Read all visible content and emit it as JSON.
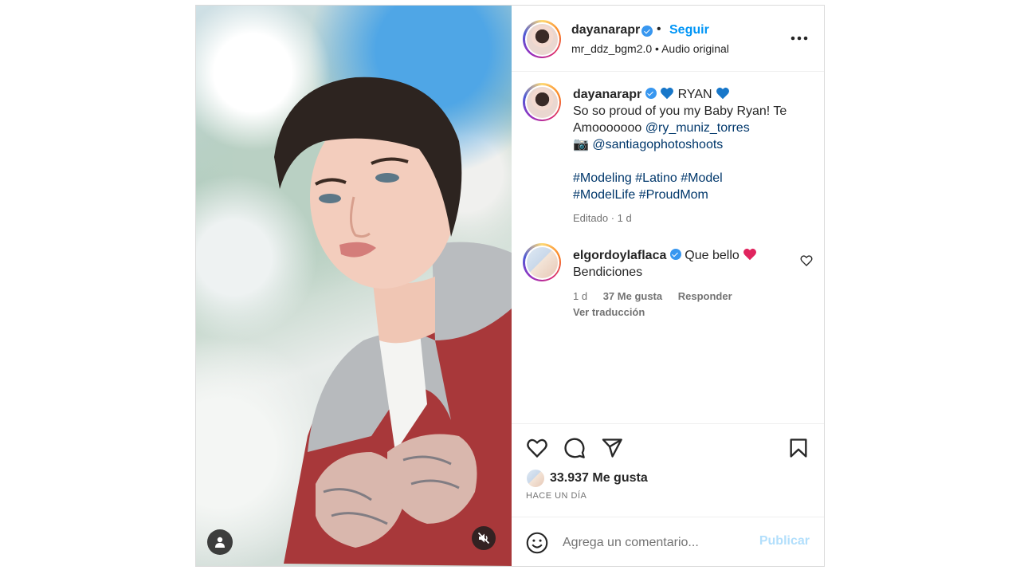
{
  "post": {
    "author": "dayanarapr",
    "follow_label": "Seguir",
    "separator": "•",
    "audio": "mr_ddz_bgm2.0 • Audio original",
    "more_icon": "more-horizontal-icon"
  },
  "caption": {
    "username": "dayanarapr",
    "line1_text": "RYAN",
    "line2": "So so proud of you my Baby Ryan! Te Amooooooo",
    "mention1": "@ry_muniz_torres",
    "camera_emoji": "📷",
    "mention2": "@santiagophotoshoots",
    "hashtags_line1": [
      "#Modeling",
      "#Latino",
      "#Model"
    ],
    "hashtags_line2": [
      "#ModelLife",
      "#ProudMom"
    ],
    "meta": "Editado · 1 d"
  },
  "comment": {
    "username": "elgordoylaflaca",
    "text": "Que bello",
    "text2": "Bendiciones",
    "time": "1 d",
    "likes": "37 Me gusta",
    "reply": "Responder",
    "translate": "Ver traducción"
  },
  "actions": {
    "likes_count": "33.937 Me gusta",
    "time_ago": "HACE UN DÍA"
  },
  "add_comment": {
    "placeholder": "Agrega un comentario...",
    "publish": "Publicar"
  },
  "colors": {
    "accent": "#0095f6",
    "verified": "#3897f0",
    "link": "#00376b",
    "muted": "#737373",
    "heart_blue": "#1877c9",
    "heart_red": "#e0245e"
  }
}
